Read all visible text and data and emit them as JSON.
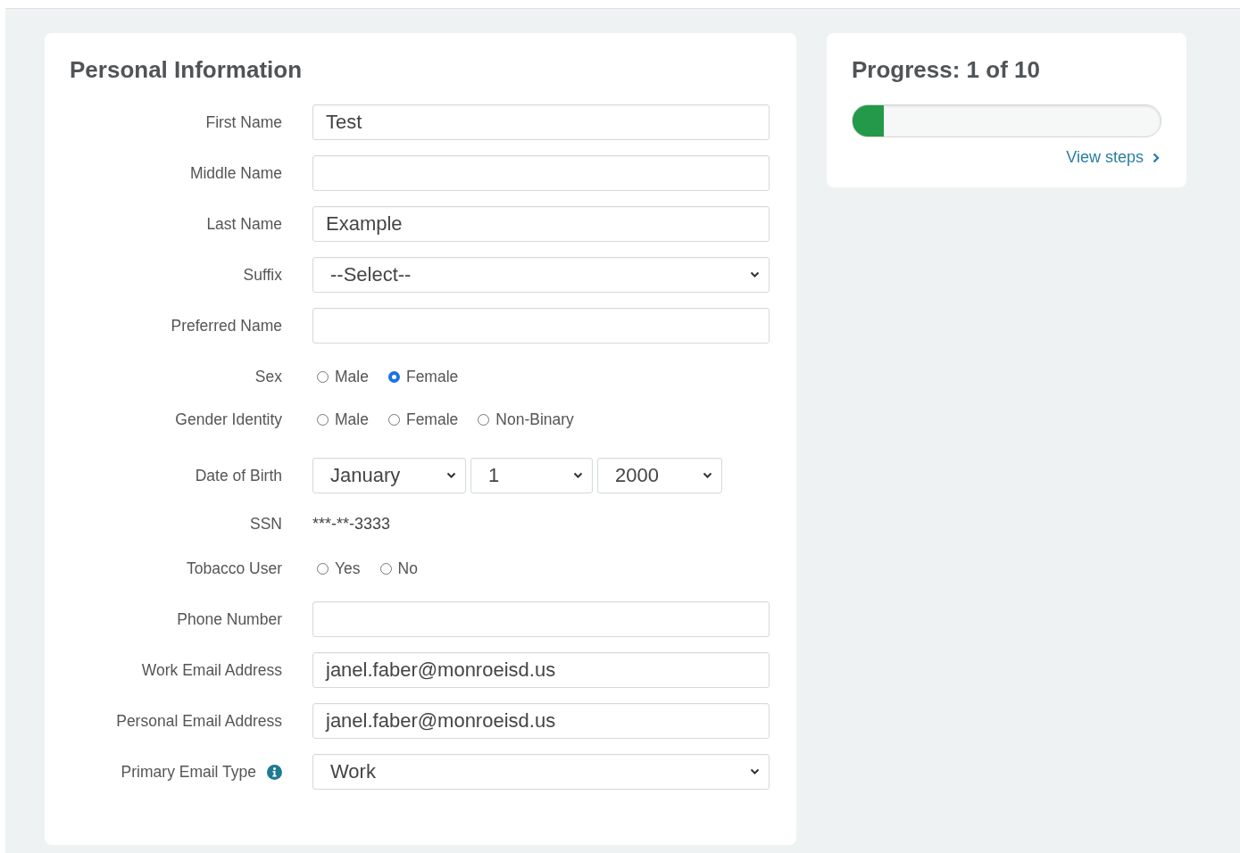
{
  "personal_information": {
    "title": "Personal Information",
    "fields": [
      {
        "kind": "text",
        "label": "First Name",
        "value": "Test"
      },
      {
        "kind": "text",
        "label": "Middle Name"
      },
      {
        "kind": "text",
        "label": "Last Name",
        "value": "Example"
      },
      {
        "kind": "select",
        "label": "Suffix",
        "value": "--Select--"
      },
      {
        "kind": "text",
        "label": "Preferred Name"
      },
      {
        "kind": "radio",
        "label": "Sex",
        "options": [
          {
            "label": "Male",
            "selected": false
          },
          {
            "label": "Female",
            "selected": true
          }
        ]
      },
      {
        "kind": "radio",
        "label": "Gender Identity",
        "options": [
          {
            "label": "Male",
            "selected": false
          },
          {
            "label": "Female",
            "selected": false
          },
          {
            "label": "Non-Binary",
            "selected": false
          }
        ]
      },
      {
        "kind": "date",
        "label": "Date of Birth",
        "parts": [
          "January",
          "1",
          "2000"
        ]
      },
      {
        "kind": "static",
        "label": "SSN",
        "value": "***-**-3333"
      },
      {
        "kind": "radio",
        "label": "Tobacco User",
        "options": [
          {
            "label": "Yes",
            "selected": false
          },
          {
            "label": "No",
            "selected": false
          }
        ]
      },
      {
        "kind": "text",
        "label": "Phone Number"
      },
      {
        "kind": "text",
        "label": "Work Email Address",
        "value": "janel.faber@monroeisd.us"
      },
      {
        "kind": "text",
        "label": "Personal Email Address",
        "value": "janel.faber@monroeisd.us"
      },
      {
        "kind": "select",
        "label": "Primary Email Type",
        "value": "Work",
        "info": true
      }
    ]
  },
  "progress": {
    "title": "Progress: 1 of 10",
    "level": 0.1,
    "link": "View steps"
  }
}
